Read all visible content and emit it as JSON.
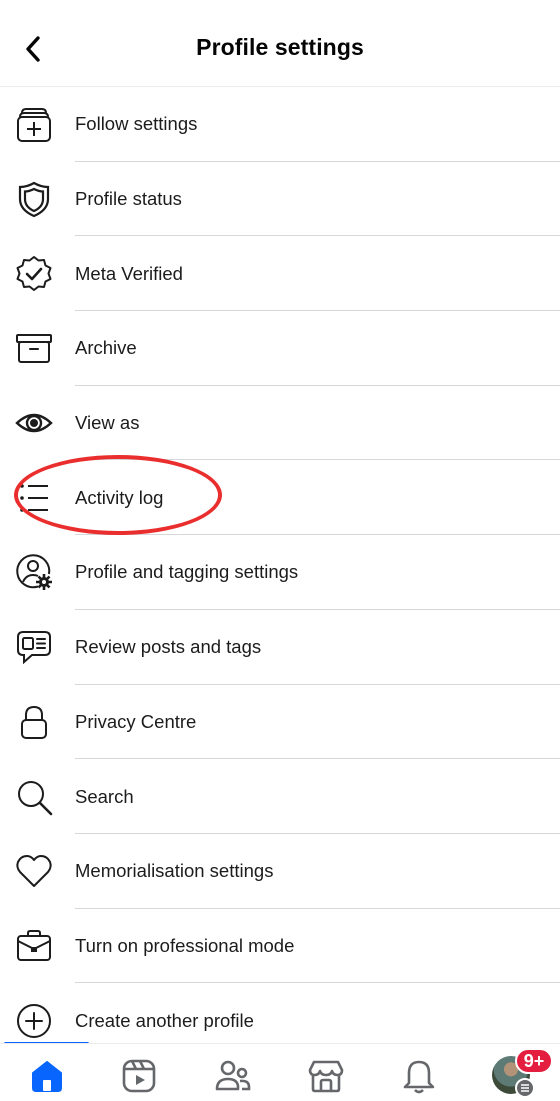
{
  "header": {
    "title": "Profile settings",
    "back_icon": "chevron-left-icon"
  },
  "items": [
    {
      "label": "Follow settings",
      "icon": "follow-add-icon"
    },
    {
      "label": "Profile status",
      "icon": "shield-icon"
    },
    {
      "label": "Meta Verified",
      "icon": "verified-badge-icon"
    },
    {
      "label": "Archive",
      "icon": "archive-box-icon"
    },
    {
      "label": "View as",
      "icon": "eye-icon"
    },
    {
      "label": "Activity log",
      "icon": "list-icon",
      "highlighted": true
    },
    {
      "label": "Profile and tagging settings",
      "icon": "user-gear-icon"
    },
    {
      "label": "Review posts and tags",
      "icon": "speech-bubble-icon"
    },
    {
      "label": "Privacy Centre",
      "icon": "lock-icon"
    },
    {
      "label": "Search",
      "icon": "search-icon"
    },
    {
      "label": "Memorialisation settings",
      "icon": "heart-icon"
    },
    {
      "label": "Turn on professional mode",
      "icon": "briefcase-icon"
    },
    {
      "label": "Create another profile",
      "icon": "plus-circle-icon"
    }
  ],
  "annotation": {
    "target": "Activity log",
    "color": "#ea2e2e"
  },
  "tabbar": {
    "active": "home",
    "accent": "#0866ff",
    "tabs": [
      {
        "name": "home",
        "icon": "home-icon"
      },
      {
        "name": "video",
        "icon": "video-icon"
      },
      {
        "name": "friends",
        "icon": "friends-icon"
      },
      {
        "name": "marketplace",
        "icon": "marketplace-icon"
      },
      {
        "name": "notifications",
        "icon": "bell-icon"
      },
      {
        "name": "menu",
        "icon": "avatar"
      }
    ],
    "badge": "9+"
  }
}
